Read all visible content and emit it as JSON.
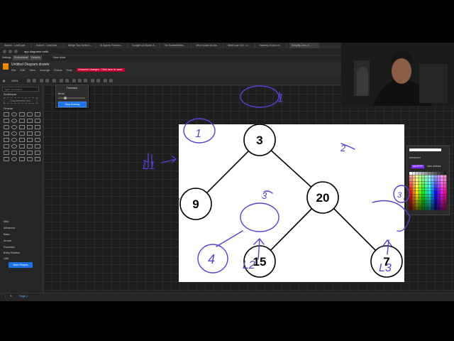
{
  "browser": {
    "tabs": [
      "Search - LeetCode",
      "Submit - LeetCode",
      "Merge Two Sorted L...",
      "AI Agents Fundam...",
      "Google's AI Mode: A...",
      "The ScalesBrains...",
      "Ultra House of Lea...",
      "NeetCode 150 - Li...",
      "Naming of dont of...",
      "Simplify Jobs: A ..."
    ],
    "url": "app.diagrams.net/#",
    "bookmarks": [
      "Settings",
      "Professional",
      "Defaults",
      "Save folder"
    ]
  },
  "app": {
    "title": "Untitled Diagram.drawio",
    "menu": [
      "File",
      "Edit",
      "View",
      "Arrange",
      "Extras",
      "Help"
    ],
    "unsaved_notice": "Unsaved changes. Click here to save.",
    "zoom": "100%"
  },
  "sidebar": {
    "search_placeholder": "Type / to search",
    "scratchpad_label": "Scratchpad",
    "drop_label": "Drag elements here",
    "sections": [
      "General",
      "Misc",
      "Advanced",
      "Basic",
      "Arrows",
      "Flowchart",
      "Entity Relation",
      "UML"
    ],
    "more_shapes": "More Shapes"
  },
  "freehand": {
    "title": "Freehand",
    "pen_label": "Brush",
    "stop_button": "Stop Drawing",
    "pen_size_fraction": 0.2
  },
  "diagram": {
    "nodes": [
      {
        "id": "n3",
        "label": "3"
      },
      {
        "id": "n9",
        "label": "9"
      },
      {
        "id": "n20",
        "label": "20"
      },
      {
        "id": "n15",
        "label": "15"
      },
      {
        "id": "n7",
        "label": "7"
      }
    ],
    "annotations": [
      "1",
      "1",
      "2",
      "3",
      "4",
      "3",
      "L1",
      "L2",
      "L3"
    ]
  },
  "color_panel": {
    "hex_value": "#A4FFFF",
    "mode_label": "Advanced",
    "user_defined": "User defined"
  },
  "status": {
    "page_label": "Page-1"
  },
  "colors": {
    "ink": "#5a3fd1",
    "node_fill": "#ffffff",
    "node_stroke": "#000000",
    "accent": "#1a73e8"
  }
}
